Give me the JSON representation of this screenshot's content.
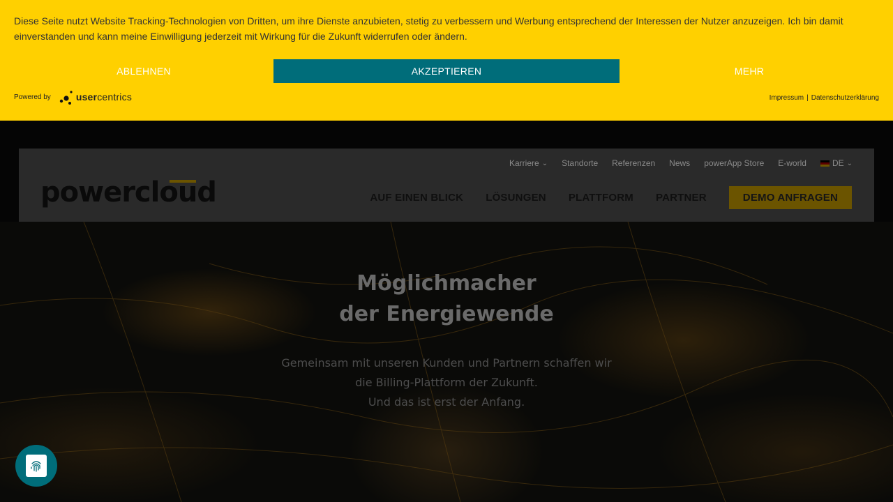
{
  "cookie_banner": {
    "text": "Diese Seite nutzt Website Tracking-Technologien von Dritten, um ihre Dienste anzubieten, stetig zu verbessern und Werbung entsprechend der Interessen der Nutzer anzuzeigen. Ich bin damit einverstanden und kann meine Einwilligung jederzeit mit Wirkung für die Zukunft widerrufen oder ändern.",
    "deny_label": "ABLEHNEN",
    "accept_label": "AKZEPTIEREN",
    "more_label": "MEHR",
    "powered_by": "Powered by",
    "brand_prefix": "user",
    "brand_suffix": "centrics",
    "impressum": "Impressum",
    "separator": "|",
    "privacy": "Datenschutzerklärung",
    "colors": {
      "background": "#ffd000",
      "accept": "#006d7a"
    }
  },
  "header": {
    "logo": "powercloud",
    "top_nav": [
      "Karriere",
      "Standorte",
      "Referenzen",
      "News",
      "powerApp Store",
      "E-world"
    ],
    "language": "DE",
    "main_nav": [
      "AUF EINEN BLICK",
      "LÖSUNGEN",
      "PLATTFORM",
      "PARTNER"
    ],
    "cta_label": "DEMO ANFRAGEN"
  },
  "hero": {
    "title_line1": "Möglichmacher",
    "title_line2": "der Energiewende",
    "subtitle_line1": "Gemeinsam mit unseren Kunden und Partnern schaffen wir",
    "subtitle_line2": "die Billing-Plattform der Zukunft.",
    "subtitle_line3": "Und das ist erst der Anfang."
  },
  "privacy_button": {
    "icon": "fingerprint-icon"
  }
}
